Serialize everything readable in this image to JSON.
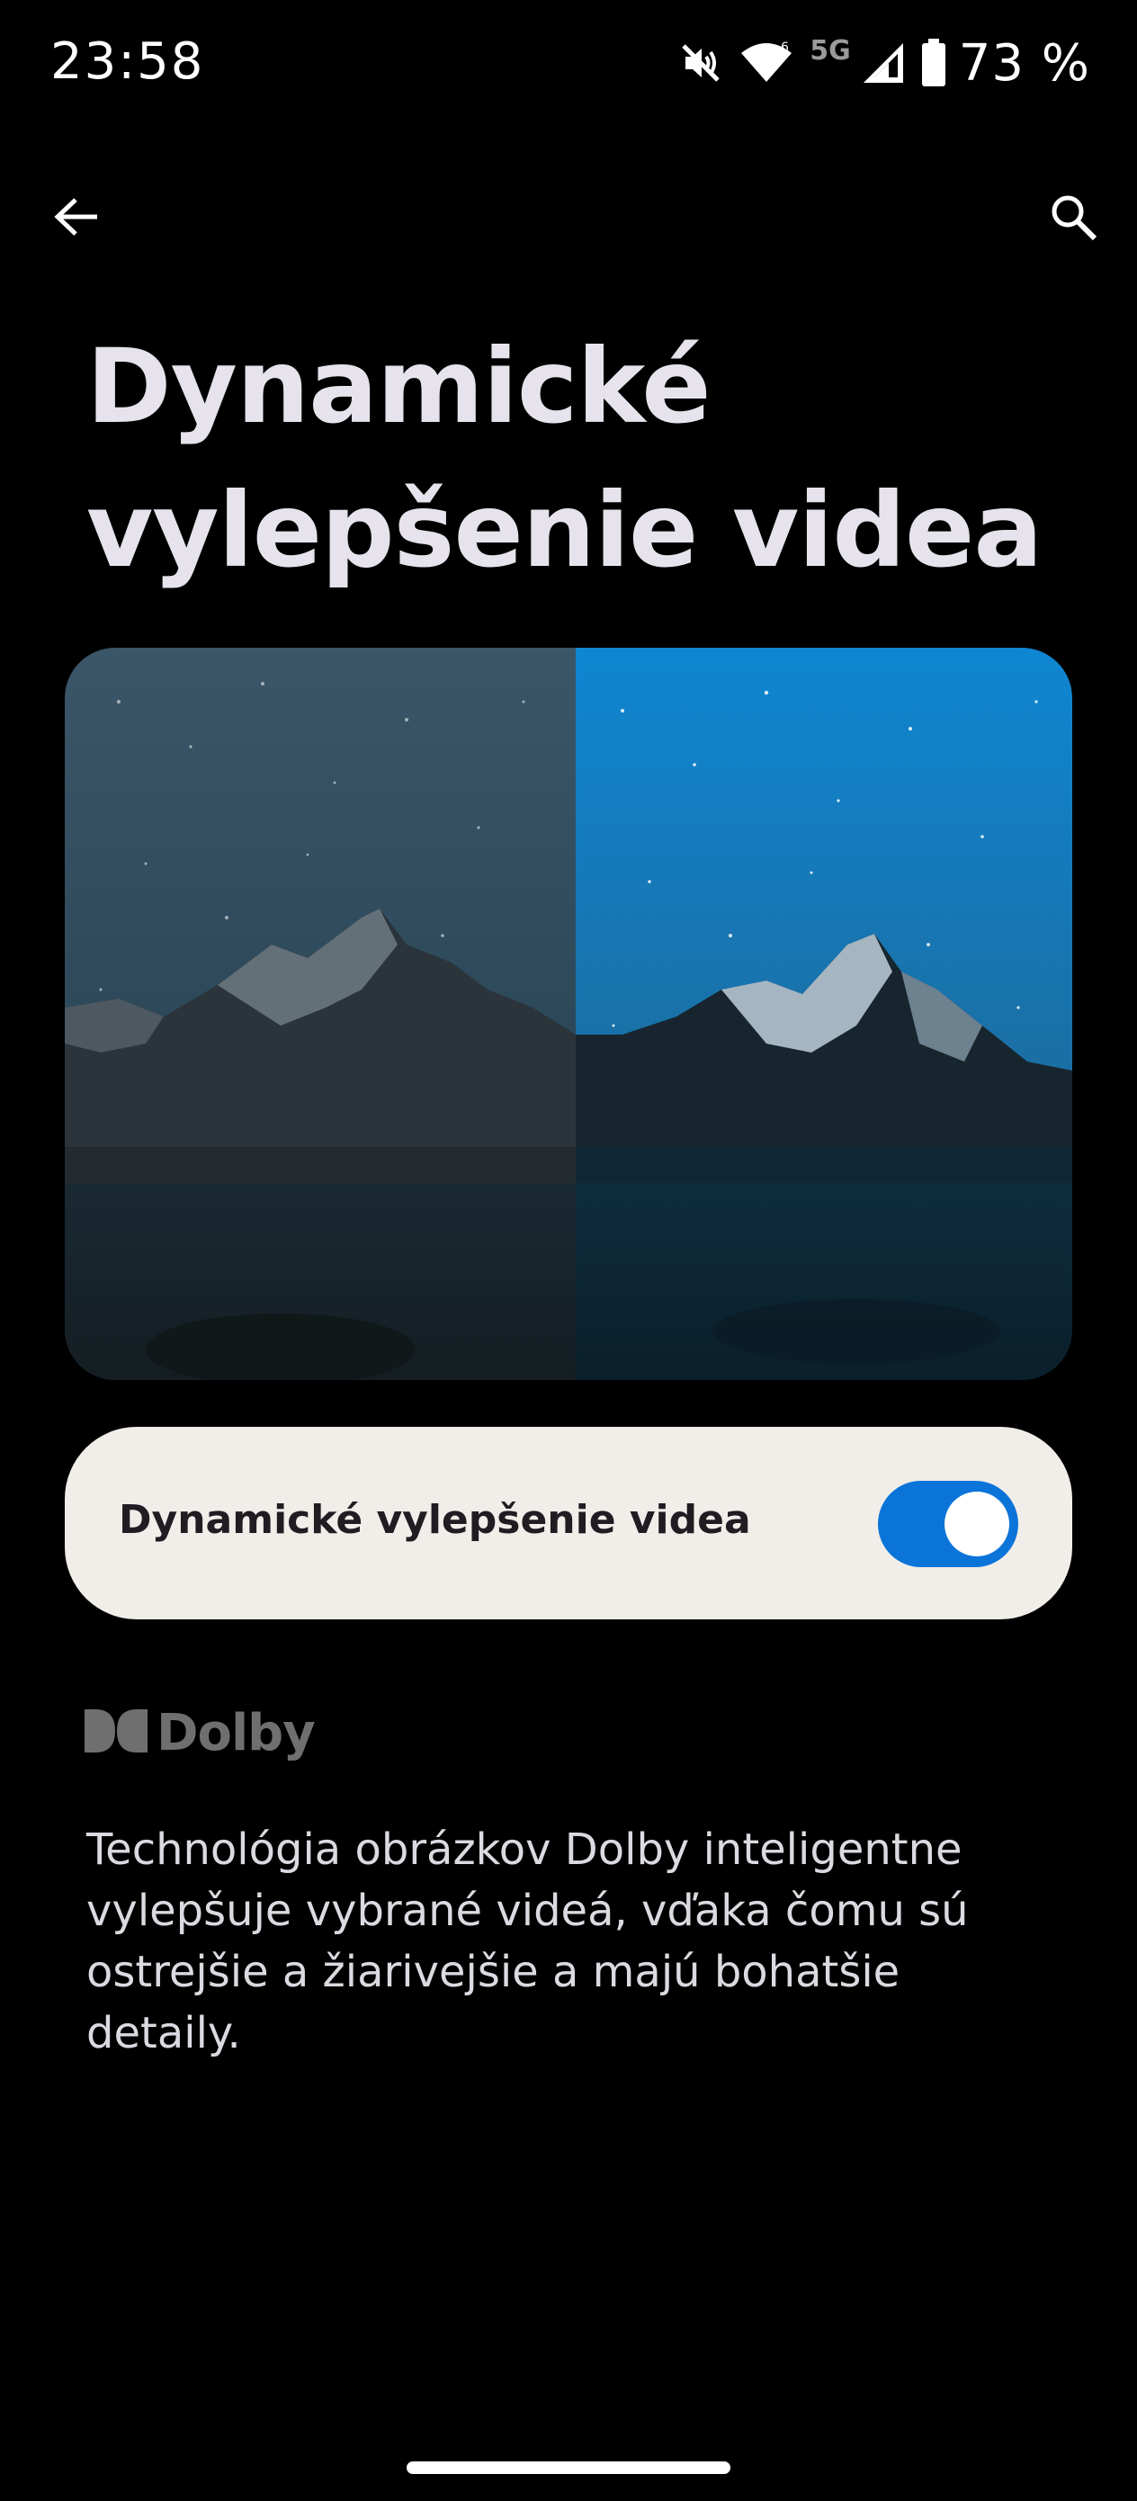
{
  "status_bar": {
    "time": "23:58",
    "network": "5G",
    "battery": "73 %",
    "icons": [
      "mute-vibrate-icon",
      "wifi-icon",
      "signal-icon",
      "battery-icon"
    ]
  },
  "app_bar": {
    "back_icon": "arrow-back-icon",
    "search_icon": "search-icon"
  },
  "page": {
    "title": "Dynamické vylepšenie videa"
  },
  "illustration": {
    "description_icon": "before-after-mountain-image"
  },
  "toggle": {
    "label": "Dynamické vylepšenie videa",
    "enabled": true,
    "accent_color": "#0b74d8"
  },
  "dolby": {
    "wordmark": "Dolby"
  },
  "description": {
    "text": "Technológia obrázkov Dolby inteligentne vylepšuje vybrané videá, vďaka čomu sú ostrejšie a žiarivejšie a majú bohatšie detaily."
  }
}
